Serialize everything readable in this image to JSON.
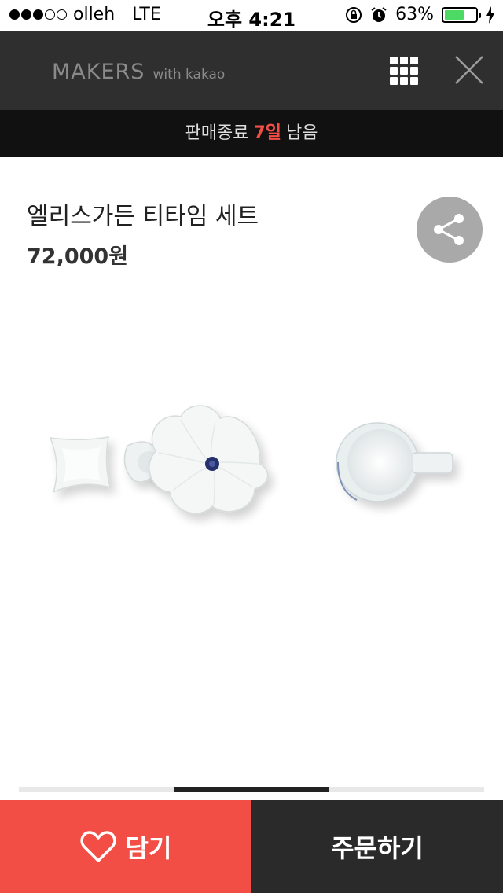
{
  "status_bar": {
    "carrier": "olleh",
    "network": "LTE",
    "time": "오후 4:21",
    "battery_percent": "63%",
    "battery_level": 0.63,
    "signal_bars_filled": 3,
    "signal_bars_total": 5
  },
  "header": {
    "brand": "MAKERS",
    "brand_suffix": "with kakao",
    "icons": [
      "grid-menu-icon",
      "close-icon"
    ]
  },
  "countdown": {
    "prefix": "판매종료",
    "days": "7일",
    "suffix": "남음",
    "highlight_color": "#f24e46"
  },
  "product": {
    "title": "엘리스가든 티타임 세트",
    "price": "72,000원"
  },
  "carousel": {
    "current_page": 2,
    "total_pages": 3
  },
  "actions": {
    "wish_label": "담기",
    "order_label": "주문하기"
  },
  "colors": {
    "accent": "#f24e46",
    "header_bg": "#2f2f2f",
    "dark_button": "#2a2a2a"
  }
}
